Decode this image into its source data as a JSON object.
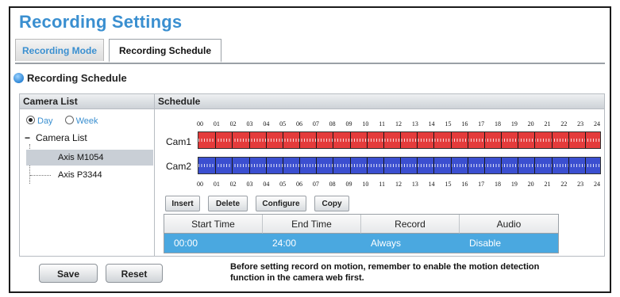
{
  "page": {
    "title": "Recording Settings"
  },
  "tabs": [
    {
      "label": "Recording Mode",
      "active": false
    },
    {
      "label": "Recording Schedule",
      "active": true
    }
  ],
  "section": {
    "title": "Recording Schedule",
    "icon": "blue-dot-icon"
  },
  "camera_list": {
    "header": "Camera List",
    "view_options": [
      {
        "label": "Day",
        "selected": true
      },
      {
        "label": "Week",
        "selected": false
      }
    ],
    "root_label": "Camera List",
    "cameras": [
      {
        "label": "Axis M1054",
        "selected": true
      },
      {
        "label": "Axis P3344",
        "selected": false
      }
    ]
  },
  "schedule": {
    "header": "Schedule",
    "hours": [
      "00",
      "01",
      "02",
      "03",
      "04",
      "05",
      "06",
      "07",
      "08",
      "09",
      "10",
      "11",
      "12",
      "13",
      "14",
      "15",
      "16",
      "17",
      "18",
      "19",
      "20",
      "21",
      "22",
      "23",
      "24"
    ],
    "tracks": [
      {
        "label": "Cam1",
        "color": "#e43b3b"
      },
      {
        "label": "Cam2",
        "color": "#3b4fd0"
      }
    ],
    "buttons": [
      "Insert",
      "Delete",
      "Configure",
      "Copy"
    ],
    "table": {
      "columns": [
        "Start Time",
        "End Time",
        "Record",
        "Audio"
      ],
      "rows": [
        [
          "00:00",
          "24:00",
          "Always",
          "Disable"
        ]
      ]
    }
  },
  "footer": {
    "save_label": "Save",
    "reset_label": "Reset",
    "note_line1": "Before setting record on motion, remember to enable the motion detection",
    "note_line2": "function in the camera web first."
  },
  "colors": {
    "accent": "#3a8fd0",
    "row_highlight": "#4aa8e0"
  }
}
